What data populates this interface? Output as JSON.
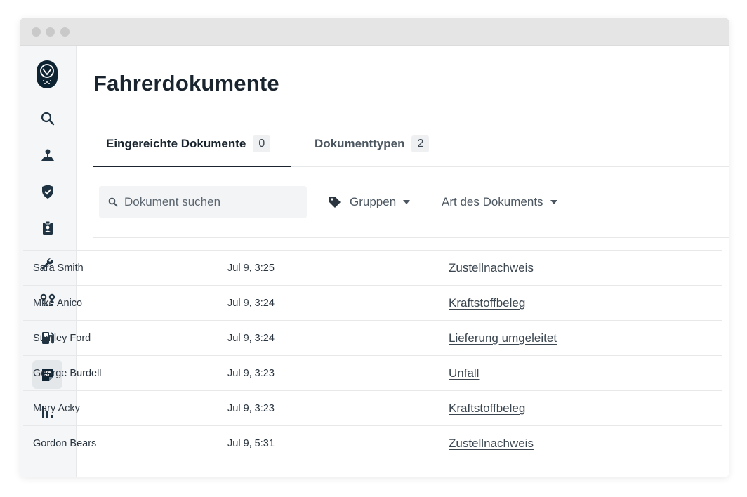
{
  "page": {
    "title": "Fahrerdokumente"
  },
  "sidebar": {
    "items": [
      {
        "icon": "search-icon"
      },
      {
        "icon": "map-person-icon"
      },
      {
        "icon": "shield-check-icon"
      },
      {
        "icon": "clipboard-person-icon"
      },
      {
        "icon": "wrench-icon"
      },
      {
        "icon": "route-icon"
      },
      {
        "icon": "fuel-icon"
      },
      {
        "icon": "document-icon",
        "active": true
      },
      {
        "icon": "bar-chart-icon"
      }
    ]
  },
  "tabs": [
    {
      "label": "Eingereichte Dokumente",
      "count": "0",
      "active": true
    },
    {
      "label": "Dokumenttypen",
      "count": "2"
    }
  ],
  "filters": {
    "search_placeholder": "Dokument suchen",
    "groups_label": "Gruppen",
    "doctype_label": "Art des Dokuments"
  },
  "rows": [
    {
      "name": "Sara Smith",
      "time": "Jul 9, 3:25",
      "doc": "Zustellnachweis"
    },
    {
      "name": "Mike Anico",
      "time": "Jul 9, 3:24",
      "doc": "Kraftstoffbeleg"
    },
    {
      "name": "Stanley Ford",
      "time": "Jul 9, 3:24",
      "doc": "Lieferung umgeleitet"
    },
    {
      "name": "George Burdell",
      "time": "Jul 9, 3:23",
      "doc": "Unfall"
    },
    {
      "name": "Mary Acky",
      "time": "Jul 9, 3:23",
      "doc": "Kraftstoffbeleg"
    },
    {
      "name": "Gordon Bears",
      "time": "Jul 9, 5:31",
      "doc": "Zustellnachweis"
    }
  ],
  "colors": {
    "navy": "#0f2433",
    "icon": "#1f3342",
    "text": "#19242e"
  }
}
